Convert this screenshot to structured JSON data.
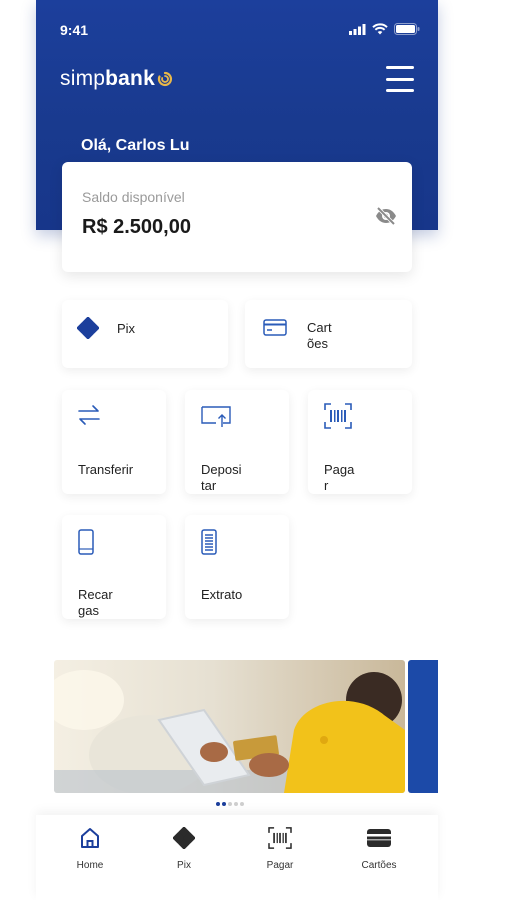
{
  "status": {
    "time": "9:41"
  },
  "header": {
    "logo_regular": "simp",
    "logo_bold": "bank",
    "greeting": "Olá, Carlos Lu"
  },
  "balance": {
    "label": "Saldo disponível",
    "value": "R$ 2.500,00"
  },
  "quick": [
    {
      "label": "Pix",
      "icon": "pix-icon"
    },
    {
      "label": "Cartões",
      "icon": "card-icon"
    }
  ],
  "actions": [
    {
      "label": "Transferir",
      "icon": "transfer-icon"
    },
    {
      "label": "Depositar",
      "icon": "deposit-icon"
    },
    {
      "label": "Pagar",
      "icon": "barcode-icon"
    },
    {
      "label": "Recargas",
      "icon": "phone-icon"
    },
    {
      "label": "Extrato",
      "icon": "statement-icon"
    }
  ],
  "carousel": {
    "slides": 5,
    "active": 1
  },
  "nav": [
    {
      "label": "Home",
      "icon": "home-icon"
    },
    {
      "label": "Pix",
      "icon": "pix-icon"
    },
    {
      "label": "Pagar",
      "icon": "barcode-icon"
    },
    {
      "label": "Cartões",
      "icon": "wallet-icon"
    }
  ],
  "colors": {
    "brand_blue": "#1c3f9c",
    "icon_blue": "#2a5bb8",
    "logo_gold": "#e8b84a"
  }
}
